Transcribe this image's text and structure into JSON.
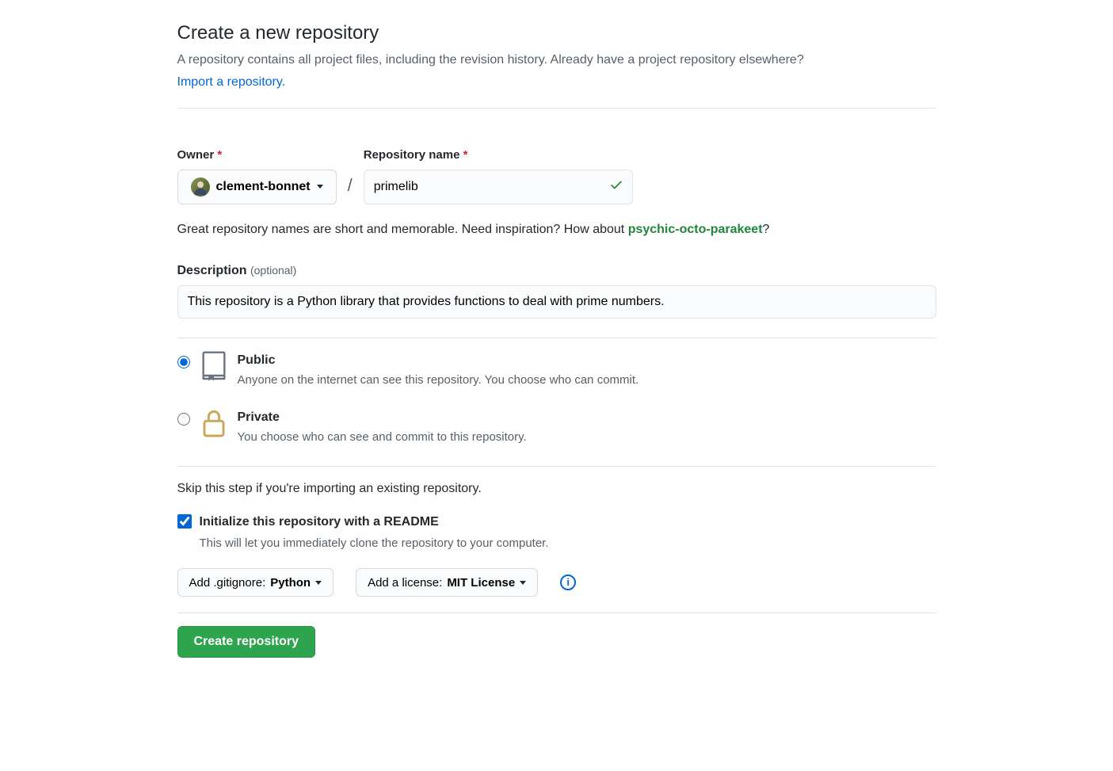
{
  "header": {
    "title": "Create a new repository",
    "subtitle": "A repository contains all project files, including the revision history. Already have a project repository elsewhere?",
    "import_link": "Import a repository."
  },
  "owner": {
    "label": "Owner",
    "username": "clement-bonnet"
  },
  "repo": {
    "label": "Repository name",
    "value": "primelib"
  },
  "helper": {
    "text_before": "Great repository names are short and memorable. Need inspiration? How about ",
    "suggestion": "psychic-octo-parakeet",
    "text_after": "?"
  },
  "description": {
    "label": "Description",
    "optional": "(optional)",
    "value": "This repository is a Python library that provides functions to deal with prime numbers."
  },
  "visibility": {
    "public": {
      "title": "Public",
      "desc": "Anyone on the internet can see this repository. You choose who can commit."
    },
    "private": {
      "title": "Private",
      "desc": "You choose who can see and commit to this repository."
    },
    "selected": "public"
  },
  "init": {
    "skip_text": "Skip this step if you're importing an existing repository.",
    "readme_label": "Initialize this repository with a README",
    "readme_desc": "This will let you immediately clone the repository to your computer.",
    "readme_checked": true
  },
  "gitignore": {
    "prefix": "Add .gitignore: ",
    "value": "Python"
  },
  "license": {
    "prefix": "Add a license: ",
    "value": "MIT License"
  },
  "submit": "Create repository"
}
